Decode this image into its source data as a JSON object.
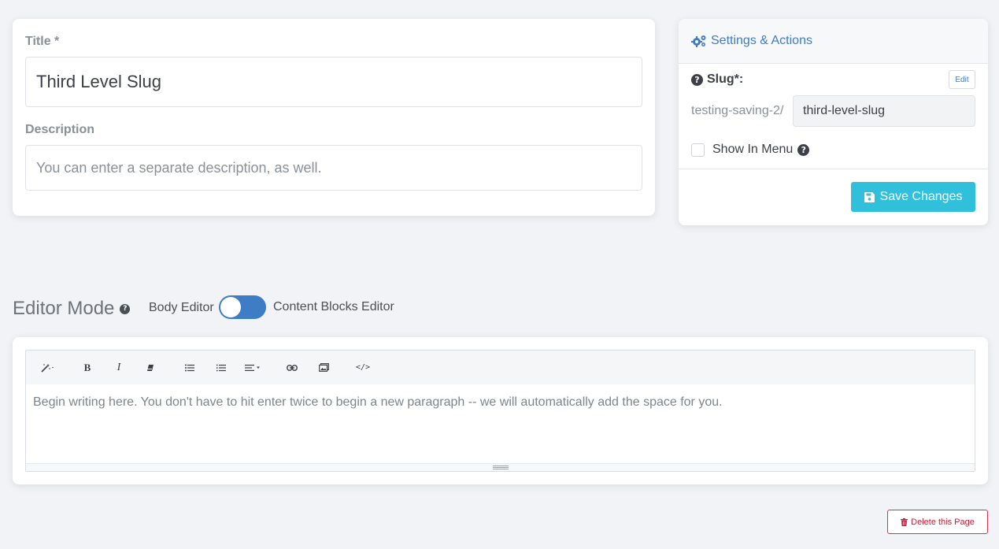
{
  "title_section": {
    "title_label": "Title *",
    "title_value": "Third Level Slug",
    "description_label": "Description",
    "description_placeholder": "You can enter a separate description, as well."
  },
  "settings": {
    "header": "Settings & Actions",
    "slug_label": "Slug*:",
    "edit_label": "Edit",
    "slug_prefix": "testing-saving-2/",
    "slug_value": "third-level-slug",
    "show_in_menu_label": "Show In Menu",
    "show_in_menu_checked": false,
    "save_label": "Save Changes"
  },
  "editor_mode": {
    "title": "Editor Mode",
    "body_editor_label": "Body Editor",
    "content_blocks_label": "Content Blocks Editor",
    "toggle_on": true
  },
  "editor": {
    "toolbar": [
      {
        "group": "style",
        "icons": [
          "magic-wand-icon"
        ]
      },
      {
        "group": "font",
        "icons": [
          "bold-icon",
          "italic-icon",
          "eraser-icon"
        ]
      },
      {
        "group": "para",
        "icons": [
          "unordered-list-icon",
          "ordered-list-icon",
          "align-icon"
        ]
      },
      {
        "group": "insert",
        "icons": [
          "link-icon",
          "picture-icon"
        ]
      },
      {
        "group": "view",
        "icons": [
          "code-view-icon"
        ]
      }
    ],
    "placeholder": "Begin writing here. You don't have to hit enter twice to begin a new paragraph -- we will automatically add the space for you."
  },
  "delete_label": "Delete this Page",
  "colors": {
    "accent": "#3e7cc6",
    "save": "#31c0dc",
    "danger": "#c4213d",
    "background": "#f2f3f6"
  }
}
